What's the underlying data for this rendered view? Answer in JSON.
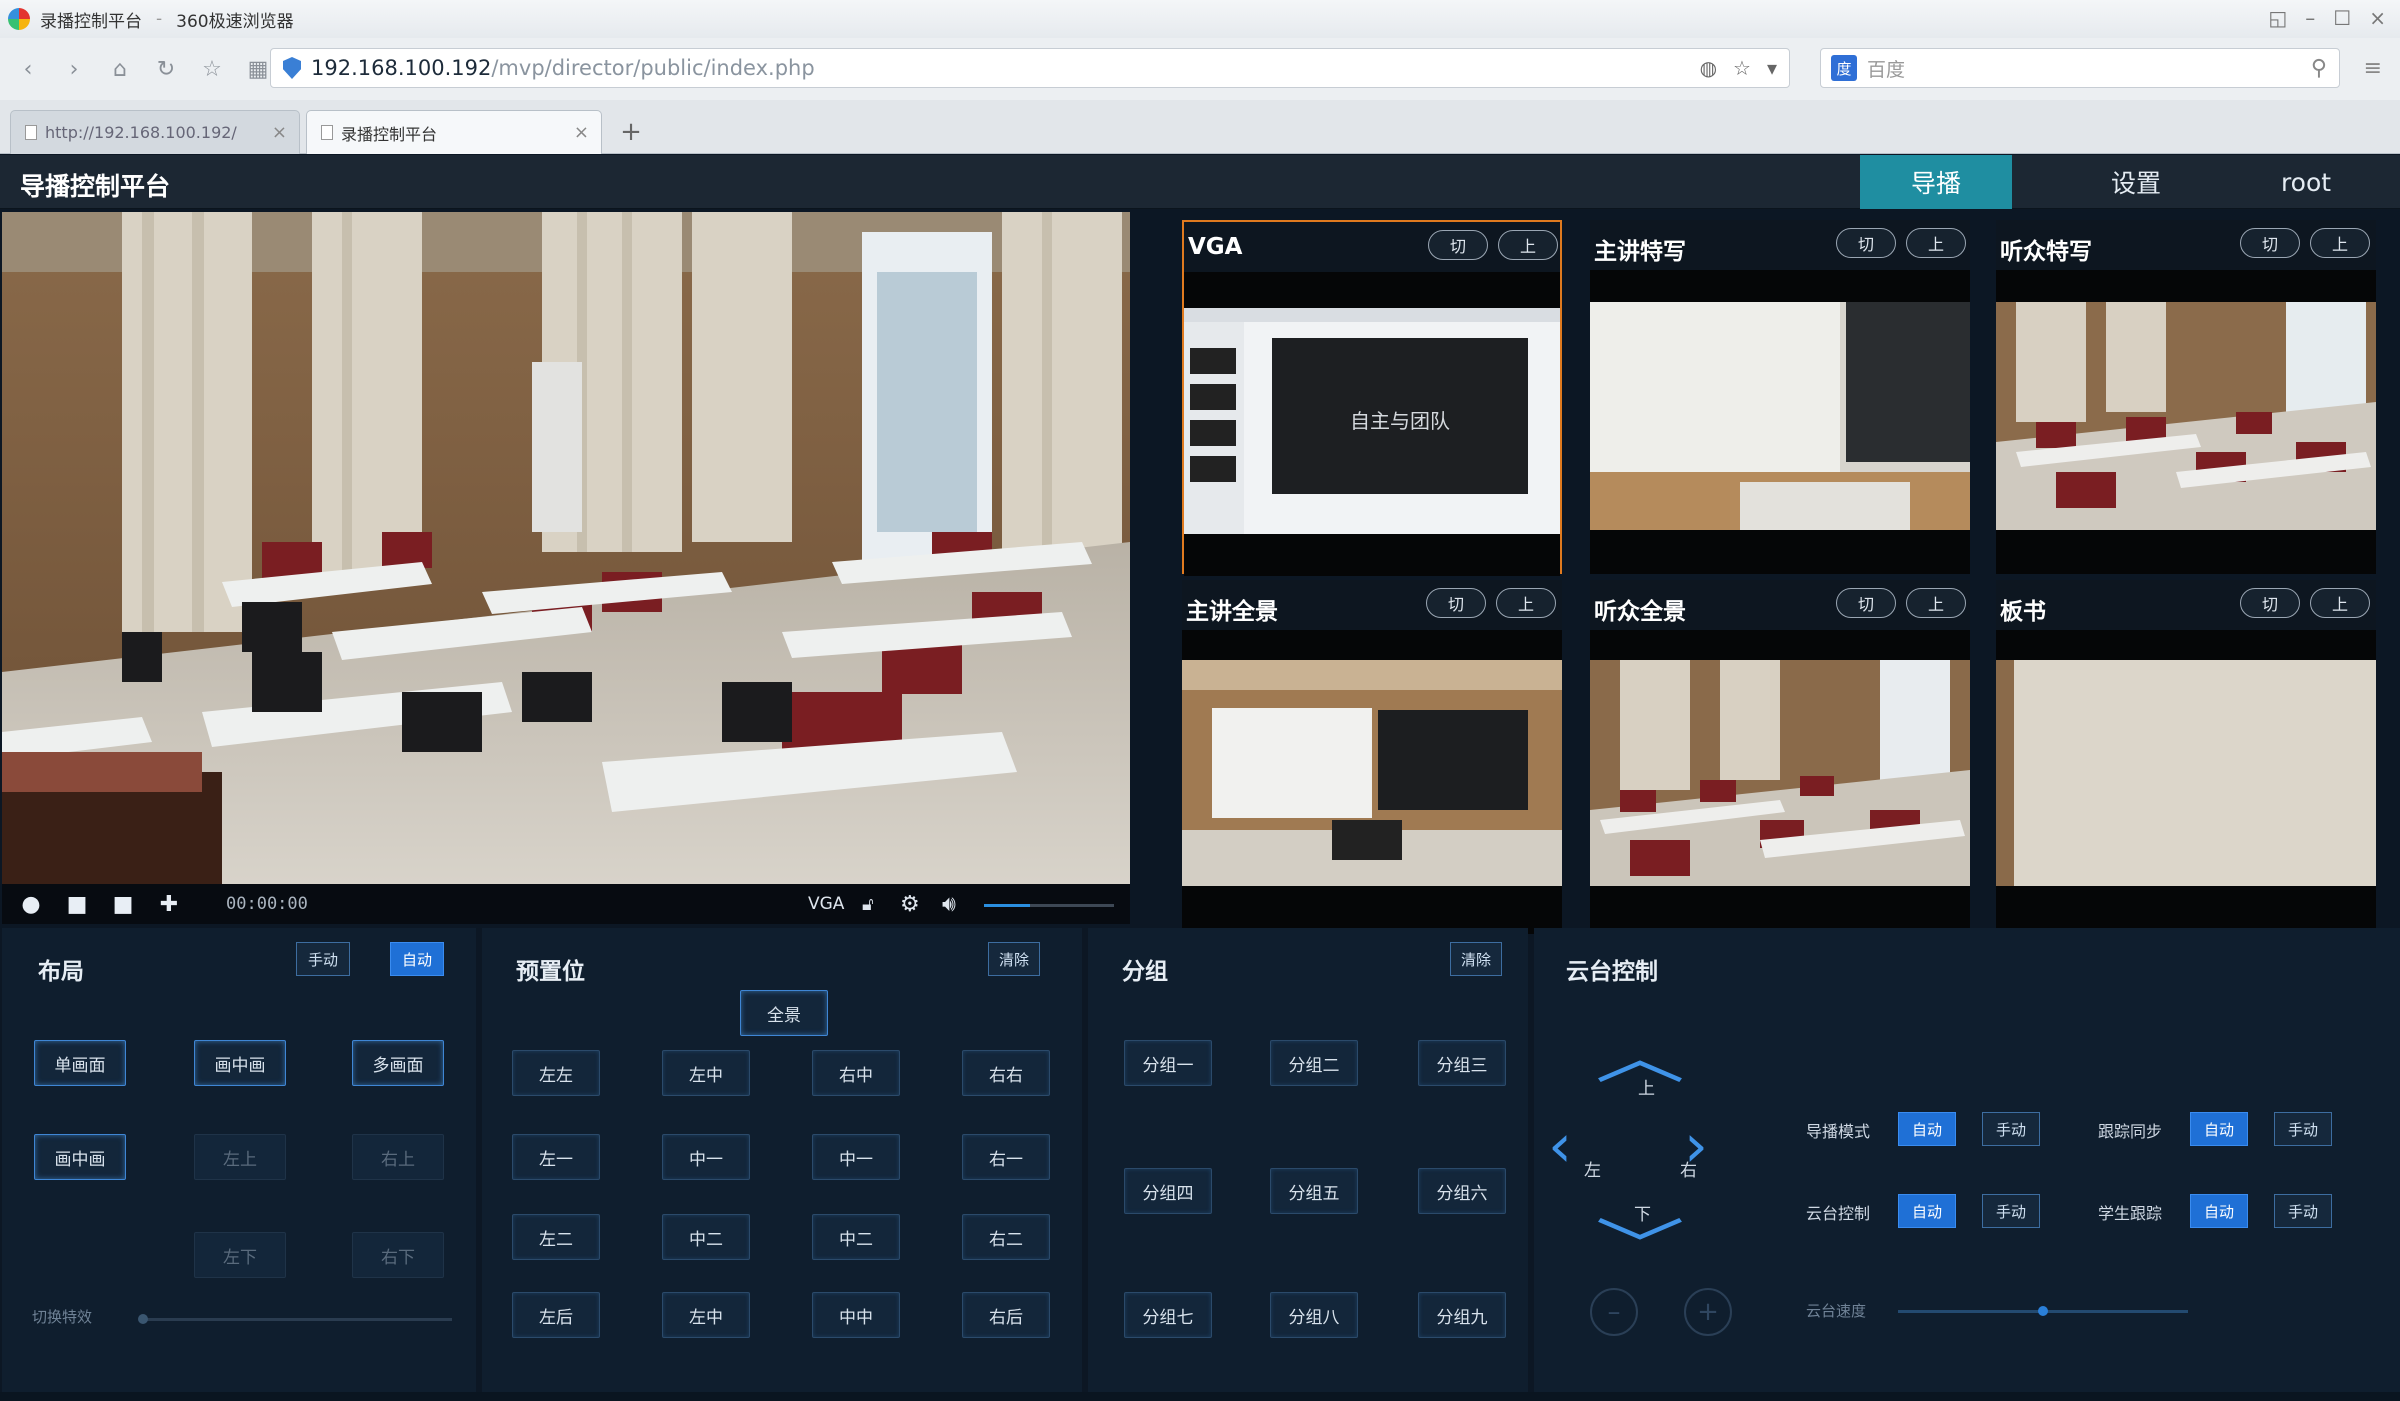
{
  "browser": {
    "window_title": "录播控制平台",
    "app_name": "360极速浏览器",
    "url_host": "192.168.100.192",
    "url_path": "/mvp/director/public/index.php",
    "search_placeholder": "百度",
    "tabs": [
      {
        "label": "http://192.168.100.192/"
      },
      {
        "label": "录播控制平台"
      }
    ]
  },
  "app": {
    "title": "导播控制平台",
    "menu": [
      {
        "label": "导播",
        "active": true
      },
      {
        "label": "设置",
        "active": false
      },
      {
        "label": "root",
        "active": false
      }
    ],
    "accent_color": "#1f8ea1"
  },
  "main_video": {
    "time": "00:00:00",
    "source": "VGA",
    "volume": 0.35
  },
  "thumbnails": [
    {
      "title": "VGA",
      "btn1": "切",
      "btn2": "上",
      "selected": true,
      "screen_text": "自主与团队"
    },
    {
      "title": "主讲特写",
      "btn1": "切",
      "btn2": "上"
    },
    {
      "title": "听众特写",
      "btn1": "切",
      "btn2": "上"
    },
    {
      "title": "主讲全景",
      "btn1": "切",
      "btn2": "上"
    },
    {
      "title": "听众全景",
      "btn1": "切",
      "btn2": "上"
    },
    {
      "title": "板书",
      "btn1": "切",
      "btn2": "上"
    }
  ],
  "panels": {
    "layout": {
      "title": "布局",
      "btn_manual": "手动",
      "btn_auto": "自动",
      "buttons": [
        "单画面",
        "画中画",
        "多画面",
        "画中画",
        "左上",
        "右上",
        "左下",
        "右下"
      ],
      "slider_label": "切换特效"
    },
    "preset": {
      "title": "预置位",
      "btn_reset": "清除",
      "btn_all": "全景",
      "grid": [
        "左左",
        "左中",
        "右中",
        "右右",
        "左一",
        "中一",
        "中一",
        "右一",
        "左二",
        "中二",
        "中二",
        "右二",
        "左后",
        "左中",
        "中中",
        "右后"
      ]
    },
    "grading": {
      "title": "分组",
      "btn_reset": "清除",
      "grid": [
        "分组一",
        "分组二",
        "分组三",
        "分组四",
        "分组五",
        "分组六",
        "分组七",
        "分组八",
        "分组九"
      ]
    },
    "ptz": {
      "title": "云台控制",
      "up": "上",
      "down": "下",
      "left": "左",
      "right": "右",
      "options": [
        {
          "label": "导播模式",
          "on": "自动",
          "off": "手动"
        },
        {
          "label": "跟踪同步",
          "on": "自动",
          "off": "手动"
        },
        {
          "label": "云台控制",
          "on": "自动",
          "off": "手动"
        },
        {
          "label": "学生跟踪",
          "on": "自动",
          "off": "手动"
        }
      ],
      "speed_label": "云台速度"
    }
  }
}
